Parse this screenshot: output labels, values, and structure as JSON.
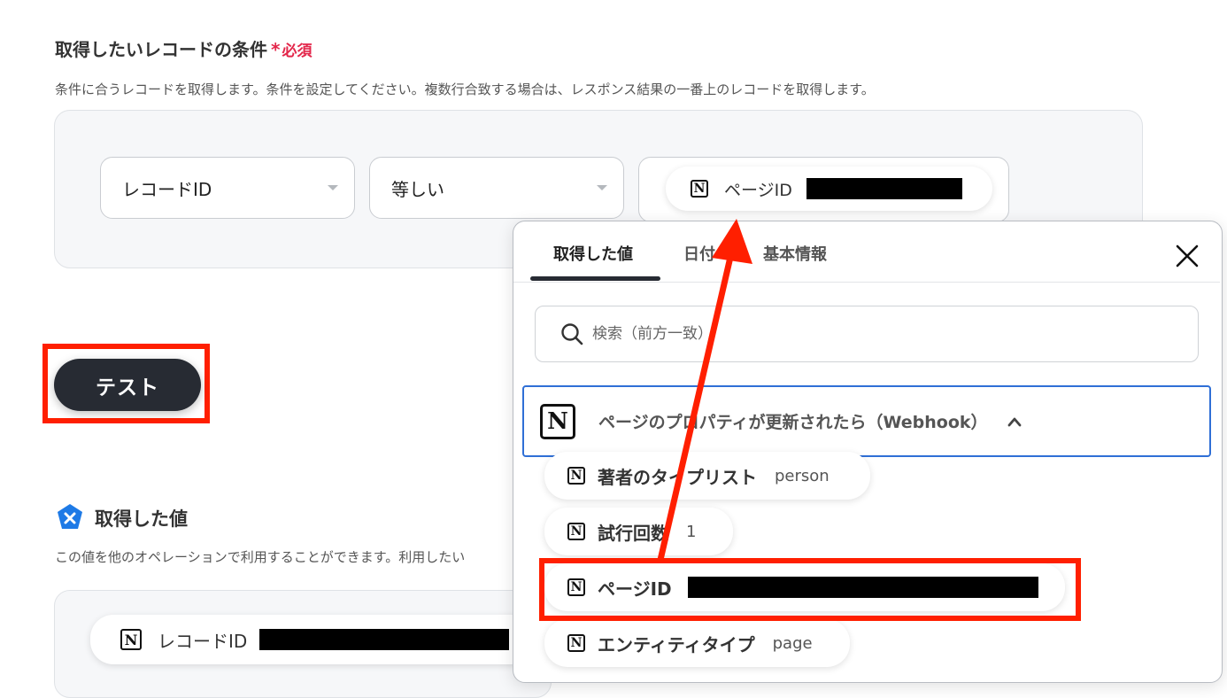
{
  "condition_section": {
    "title": "取得したいレコードの条件",
    "required_mark": "*",
    "required_label": "必須",
    "description": "条件に合うレコードを取得します。条件を設定してください。複数行合致する場合は、レスポンス結果の一番上のレコードを取得します。",
    "field_select": "レコードID",
    "operator_select": "等しい",
    "value_chip_label": "ページID"
  },
  "test_button": {
    "label": "テスト"
  },
  "results_section": {
    "title": "取得した値",
    "description": "この値を他のオペレーションで利用することができます。利用したい",
    "first_item_label": "レコードID"
  },
  "popover": {
    "tabs": [
      {
        "label": "取得した値",
        "active": true
      },
      {
        "label": "日付",
        "active": false
      },
      {
        "label": "基本情報",
        "active": false
      }
    ],
    "search_placeholder": "検索（前方一致）",
    "group_header": "ページのプロパティが更新されたら（Webhook）",
    "items": [
      {
        "label": "著者のタイプリスト",
        "value": "person"
      },
      {
        "label": "試行回数",
        "value": "1"
      },
      {
        "label": "ページID",
        "value": ""
      },
      {
        "label": "エンティティタイプ",
        "value": "page"
      }
    ]
  },
  "colors": {
    "required": "#e3264a",
    "highlight_red": "#ff1f00",
    "button_dark": "#272b33",
    "selection_blue": "#2f6fd6",
    "badge_blue": "#1e7ae6"
  },
  "icons": [
    "notion-icon",
    "search-icon",
    "close-icon",
    "chevron-up-icon",
    "caret-down-icon",
    "yoom-badge-icon"
  ]
}
